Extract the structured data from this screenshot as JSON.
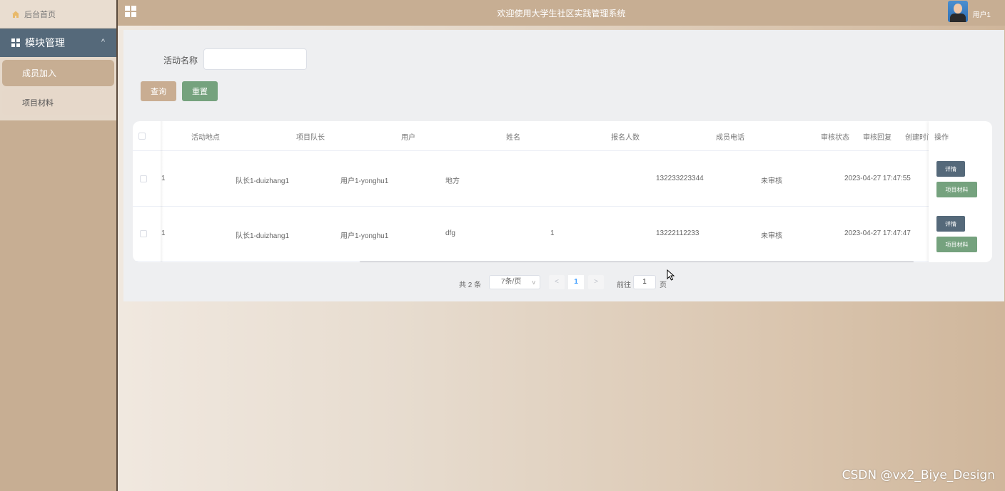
{
  "sidebar": {
    "home_label": "后台首页",
    "module_label": "模块管理",
    "items": [
      {
        "label": "成员加入",
        "active": true
      },
      {
        "label": "项目材料",
        "active": false
      }
    ]
  },
  "header": {
    "title": "欢迎使用大学生社区实践管理系统",
    "username": "用户1"
  },
  "search": {
    "label": "活动名称",
    "value": "",
    "query_label": "查询",
    "reset_label": "重置"
  },
  "table": {
    "columns": [
      "活动地点",
      "项目队长",
      "用户",
      "姓名",
      "报名人数",
      "成员电话",
      "审核状态",
      "审核回复",
      "创建时间",
      "操作"
    ],
    "rows": [
      {
        "col0": "1",
        "captain": "队长1-duizhang1",
        "user": "用户1-yonghu1",
        "name": "地方",
        "count": "",
        "phone": "132233223344",
        "status": "未审核",
        "created": "2023-04-27 17:47:55"
      },
      {
        "col0": "1",
        "captain": "队长1-duizhang1",
        "user": "用户1-yonghu1",
        "name": "dfg",
        "count": "1",
        "phone": "13222112233",
        "status": "未审核",
        "created": "2023-04-27 17:47:47"
      }
    ],
    "detail_label": "详情",
    "material_label": "项目材料"
  },
  "pagination": {
    "total": "共 2 条",
    "page_size": "7条/页",
    "current_page": "1",
    "goto_label": "前往",
    "goto_value": "1",
    "page_suffix": "页"
  },
  "watermark": "CSDN @vx2_Biye_Design",
  "colors": {
    "accent": "#c7ae93",
    "module_header": "#55697a",
    "reset_button": "#75a27e"
  }
}
